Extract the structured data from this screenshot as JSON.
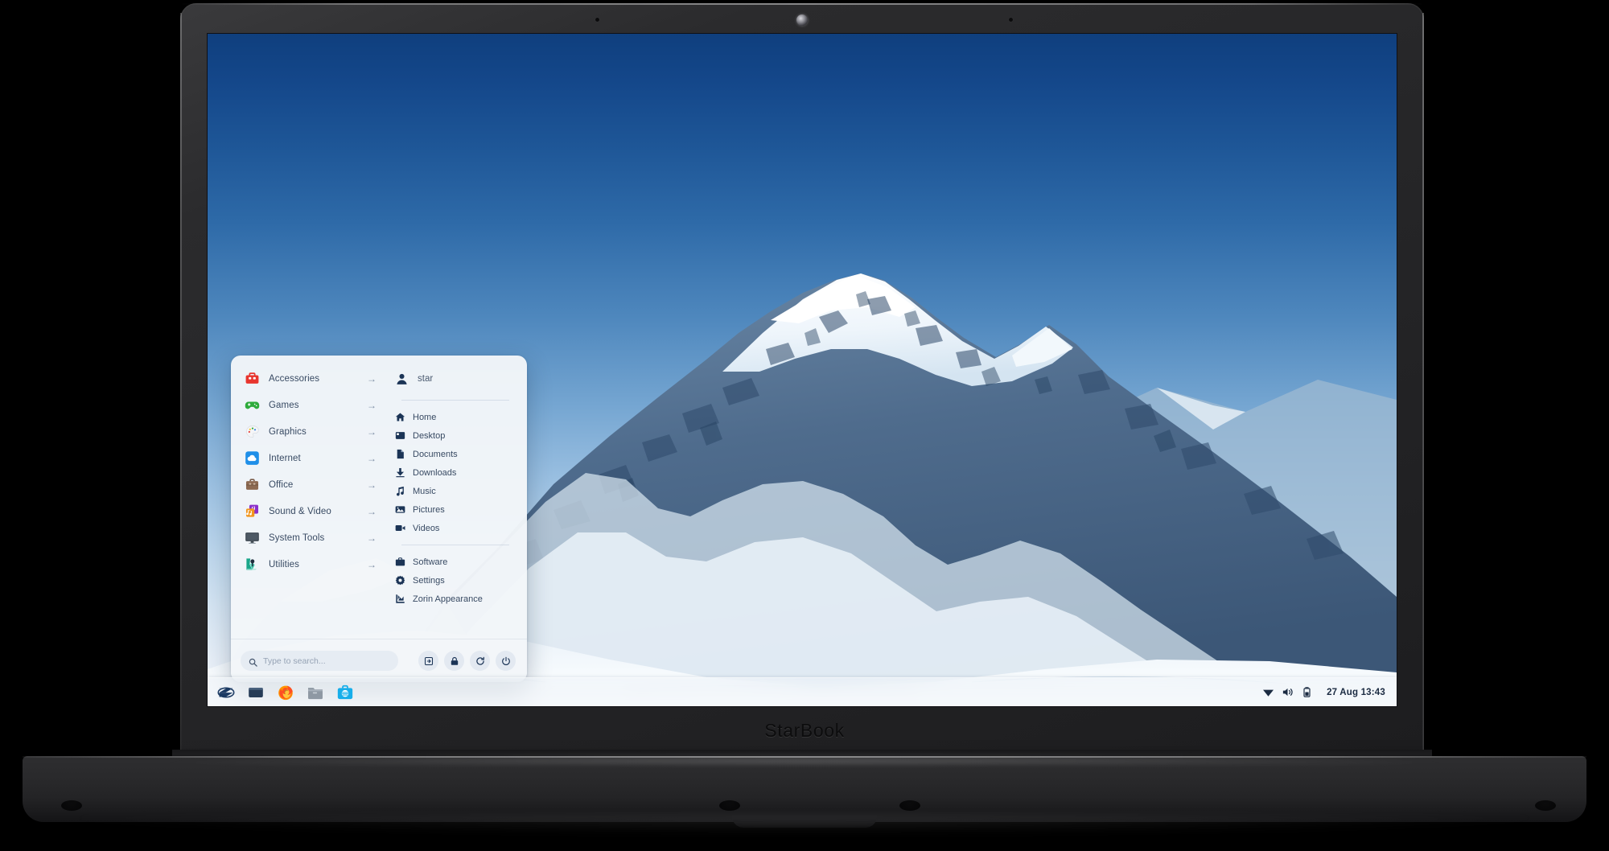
{
  "device": {
    "brand_label": "StarBook",
    "webcam_label": "webcam",
    "bezel_color": "#2b2b2d"
  },
  "desktop": {
    "wallpaper_name": "snow-mountain-wallpaper",
    "sky_top_color": "#0f3f7e",
    "sky_bottom_color": "#f2f6fa"
  },
  "menu": {
    "title": "Zorin Menu",
    "categories": [
      {
        "label": "Accessories",
        "icon": "toolbox-icon",
        "arrow": "→"
      },
      {
        "label": "Games",
        "icon": "gamepad-icon",
        "arrow": "→"
      },
      {
        "label": "Graphics",
        "icon": "palette-icon",
        "arrow": "→"
      },
      {
        "label": "Internet",
        "icon": "cloud-icon",
        "arrow": "→"
      },
      {
        "label": "Office",
        "icon": "briefcase-icon",
        "arrow": "→"
      },
      {
        "label": "Sound & Video",
        "icon": "music-video-icon",
        "arrow": "→"
      },
      {
        "label": "System Tools",
        "icon": "monitor-icon",
        "arrow": "→"
      },
      {
        "label": "Utilities",
        "icon": "utilities-icon",
        "arrow": "→"
      }
    ],
    "user": {
      "name": "star",
      "icon": "person-icon"
    },
    "places": [
      {
        "label": "Home",
        "icon": "home-icon"
      },
      {
        "label": "Desktop",
        "icon": "desktop-icon"
      },
      {
        "label": "Documents",
        "icon": "document-icon"
      },
      {
        "label": "Downloads",
        "icon": "download-icon"
      },
      {
        "label": "Music",
        "icon": "music-note-icon"
      },
      {
        "label": "Pictures",
        "icon": "picture-icon"
      },
      {
        "label": "Videos",
        "icon": "video-camera-icon"
      }
    ],
    "system_links": [
      {
        "label": "Software",
        "icon": "software-bag-icon"
      },
      {
        "label": "Settings",
        "icon": "gear-icon"
      },
      {
        "label": "Zorin Appearance",
        "icon": "appearance-icon"
      }
    ],
    "search": {
      "placeholder": "Type to search...",
      "value": "",
      "icon": "search-icon"
    },
    "session_buttons": [
      {
        "name": "log-out-button",
        "icon": "logout-icon"
      },
      {
        "name": "lock-button",
        "icon": "lock-icon"
      },
      {
        "name": "restart-button",
        "icon": "restart-icon"
      },
      {
        "name": "power-button",
        "icon": "power-icon"
      }
    ]
  },
  "taskbar": {
    "launchers": [
      {
        "name": "zorin-menu-button",
        "icon": "zorin-logo-icon",
        "label": "Zorin Menu"
      },
      {
        "name": "show-desktop-button",
        "icon": "window-icon",
        "label": "Show Desktop"
      },
      {
        "name": "firefox-button",
        "icon": "firefox-icon",
        "label": "Firefox"
      },
      {
        "name": "files-button",
        "icon": "folder-icon",
        "label": "Files"
      },
      {
        "name": "software-button",
        "icon": "software-center-icon",
        "label": "Software"
      }
    ],
    "tray": [
      {
        "name": "network-tray-icon",
        "icon": "wifi-icon"
      },
      {
        "name": "volume-tray-icon",
        "icon": "speaker-icon"
      },
      {
        "name": "battery-tray-icon",
        "icon": "battery-icon"
      }
    ],
    "clock": "27 Aug  13:43"
  }
}
